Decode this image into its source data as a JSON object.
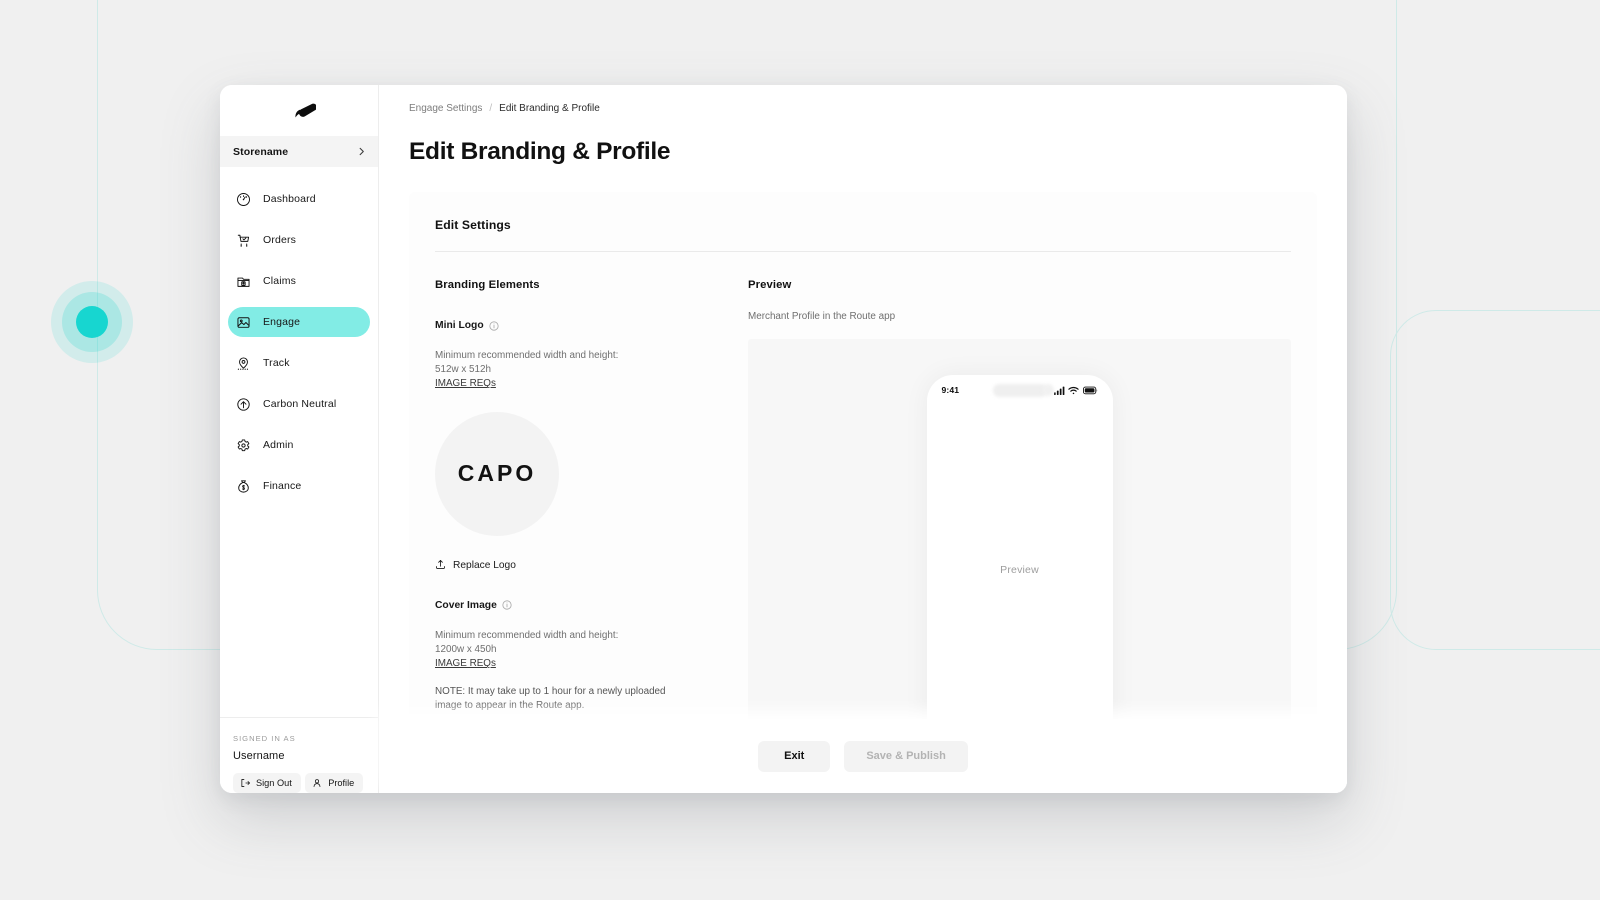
{
  "background": {
    "accent_color": "#17d6d0",
    "outline_color": "#cfeae8",
    "canvas_color": "#f0f0f0"
  },
  "sidebar": {
    "brand_icon": "route-logo-icon",
    "store": {
      "name": "Storename",
      "chevron_icon": "chevron-right-icon"
    },
    "items": [
      {
        "label": "Dashboard",
        "icon": "dashboard-gauge-icon",
        "active": false
      },
      {
        "label": "Orders",
        "icon": "shopping-cart-icon",
        "active": false
      },
      {
        "label": "Claims",
        "icon": "folder-dollar-icon",
        "active": false
      },
      {
        "label": "Engage",
        "icon": "image-picture-icon",
        "active": true
      },
      {
        "label": "Track",
        "icon": "map-pin-icon",
        "active": false
      },
      {
        "label": "Carbon Neutral",
        "icon": "arrow-up-circle-icon",
        "active": false
      },
      {
        "label": "Admin",
        "icon": "gear-icon",
        "active": false
      },
      {
        "label": "Finance",
        "icon": "money-bag-icon",
        "active": false
      }
    ],
    "footer": {
      "signed_in_label": "SIGNED IN AS",
      "username": "Username",
      "sign_out_label": "Sign Out",
      "sign_out_icon": "sign-out-icon",
      "profile_label": "Profile",
      "profile_icon": "user-icon"
    },
    "active_pill_color": "#82ece5"
  },
  "breadcrumb": {
    "parent": "Engage Settings",
    "separator": "/",
    "current": "Edit Branding & Profile"
  },
  "page": {
    "title": "Edit Branding & Profile",
    "card_title": "Edit Settings"
  },
  "branding": {
    "section_title": "Branding Elements",
    "mini_logo": {
      "label": "Mini Logo",
      "info_icon": "info-circle-icon",
      "hint": "Minimum recommended width and height:",
      "dimensions": "512w x 512h",
      "reqs_link": "IMAGE REQs",
      "logo_text": "CAPO",
      "replace_label": "Replace Logo",
      "replace_icon": "upload-icon"
    },
    "cover_image": {
      "label": "Cover Image",
      "info_icon": "info-circle-icon",
      "hint": "Minimum recommended width and height:",
      "dimensions": "1200w x 450h",
      "reqs_link": "IMAGE REQs",
      "note": "NOTE: It may take up to 1 hour for a newly uploaded image to appear in the Route app."
    }
  },
  "preview": {
    "section_title": "Preview",
    "subtitle": "Merchant Profile in the Route app",
    "phone": {
      "clock": "9:41",
      "signal_icon": "cellular-signal-icon",
      "wifi_icon": "wifi-icon",
      "battery_icon": "battery-icon",
      "placeholder_text": "Preview"
    }
  },
  "footer_actions": {
    "exit_label": "Exit",
    "save_label": "Save & Publish"
  }
}
